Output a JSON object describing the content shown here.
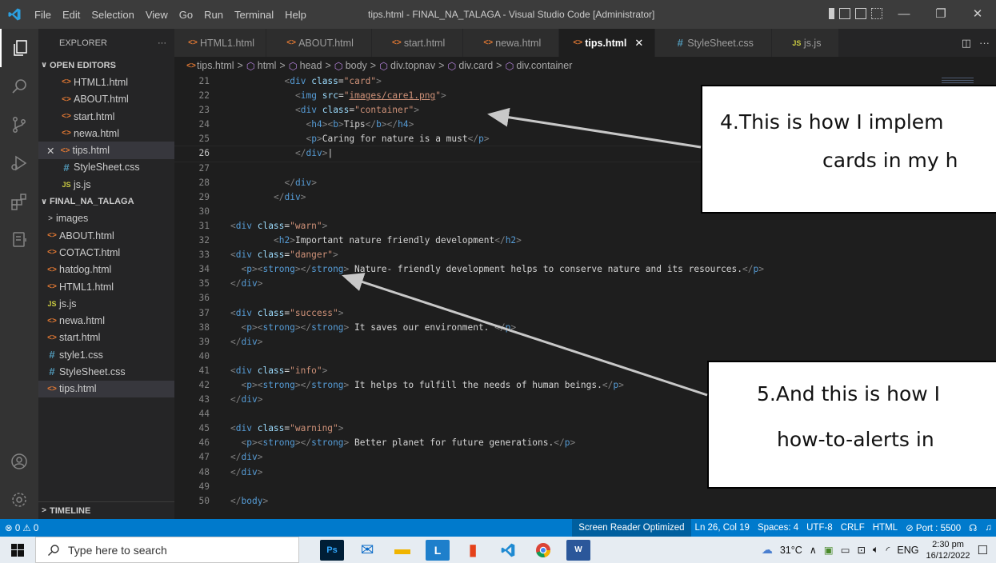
{
  "titlebar": {
    "menu": [
      "File",
      "Edit",
      "Selection",
      "View",
      "Go",
      "Run",
      "Terminal",
      "Help"
    ],
    "window_title": "tips.html - FINAL_NA_TALAGA - Visual Studio Code [Administrator]"
  },
  "sidebar": {
    "explorer_title": "EXPLORER",
    "more": "···",
    "open_editors_title": "OPEN EDITORS",
    "open_editors": [
      {
        "label": "HTML1.html",
        "icon": "html"
      },
      {
        "label": "ABOUT.html",
        "icon": "html"
      },
      {
        "label": "start.html",
        "icon": "html"
      },
      {
        "label": "newa.html",
        "icon": "html"
      },
      {
        "label": "tips.html",
        "icon": "html",
        "close": "✕"
      },
      {
        "label": "StyleSheet.css",
        "icon": "css"
      },
      {
        "label": "js.js",
        "icon": "js"
      }
    ],
    "folder_title": "FINAL_NA_TALAGA",
    "folder_items": [
      {
        "label": "images",
        "icon": "folder"
      },
      {
        "label": "ABOUT.html",
        "icon": "html"
      },
      {
        "label": "COTACT.html",
        "icon": "html"
      },
      {
        "label": "hatdog.html",
        "icon": "html"
      },
      {
        "label": "HTML1.html",
        "icon": "html"
      },
      {
        "label": "js.js",
        "icon": "js"
      },
      {
        "label": "newa.html",
        "icon": "html"
      },
      {
        "label": "start.html",
        "icon": "html"
      },
      {
        "label": "style1.css",
        "icon": "css"
      },
      {
        "label": "StyleSheet.css",
        "icon": "css"
      },
      {
        "label": "tips.html",
        "icon": "html"
      }
    ],
    "timeline_title": "TIMELINE"
  },
  "tabs": [
    {
      "label": "HTML1.html",
      "icon": "html"
    },
    {
      "label": "ABOUT.html",
      "icon": "html"
    },
    {
      "label": "start.html",
      "icon": "html"
    },
    {
      "label": "newa.html",
      "icon": "html"
    },
    {
      "label": "tips.html",
      "icon": "html",
      "active": true
    },
    {
      "label": "StyleSheet.css",
      "icon": "css"
    },
    {
      "label": "js.js",
      "icon": "js"
    }
  ],
  "breadcrumb": [
    "tips.html",
    "html",
    "head",
    "body",
    "div.topnav",
    "div.card",
    "div.container"
  ],
  "code_lines": [
    {
      "n": "21",
      "indent": 10,
      "html": "<span class='p'>&lt;</span><span class='t'>div</span> <span class='a'>class</span><span class='w'>=</span><span class='s'>\"card\"</span><span class='p'>&gt;</span>"
    },
    {
      "n": "22",
      "indent": 12,
      "html": "<span class='p'>&lt;</span><span class='t'>img</span> <span class='a'>src</span><span class='w'>=</span><span class='s'>\"<u>images/care1.png</u>\"</span><span class='p'>&gt;</span>"
    },
    {
      "n": "23",
      "indent": 12,
      "html": "<span class='p'>&lt;</span><span class='t'>div</span> <span class='a'>class</span><span class='w'>=</span><span class='s'>\"container\"</span><span class='p'>&gt;</span>"
    },
    {
      "n": "24",
      "indent": 14,
      "html": "<span class='p'>&lt;</span><span class='t'>h4</span><span class='p'>&gt;&lt;</span><span class='t'>b</span><span class='p'>&gt;</span>Tips<span class='p'>&lt;/</span><span class='t'>b</span><span class='p'>&gt;&lt;/</span><span class='t'>h4</span><span class='p'>&gt;</span>"
    },
    {
      "n": "25",
      "indent": 14,
      "html": "<span class='p'>&lt;</span><span class='t'>p</span><span class='p'>&gt;</span>Caring for nature is a must<span class='p'>&lt;/</span><span class='t'>p</span><span class='p'>&gt;</span>"
    },
    {
      "n": "26",
      "indent": 12,
      "cur": true,
      "html": "<span class='p'>&lt;/</span><span class='t'>div</span><span class='p'>&gt;</span>|"
    },
    {
      "n": "27",
      "indent": 0,
      "html": ""
    },
    {
      "n": "28",
      "indent": 10,
      "html": "<span class='p'>&lt;/</span><span class='t'>div</span><span class='p'>&gt;</span>"
    },
    {
      "n": "29",
      "indent": 8,
      "html": "<span class='p'>&lt;/</span><span class='t'>div</span><span class='p'>&gt;</span>"
    },
    {
      "n": "30",
      "indent": 0,
      "html": ""
    },
    {
      "n": "31",
      "indent": 0,
      "html": "<span class='p'>&lt;</span><span class='t'>div</span> <span class='a'>class</span><span class='w'>=</span><span class='s'>\"warn\"</span><span class='p'>&gt;</span>"
    },
    {
      "n": "32",
      "indent": 8,
      "html": "<span class='p'>&lt;</span><span class='t'>h2</span><span class='p'>&gt;</span>Important nature friendly development<span class='p'>&lt;/</span><span class='t'>h2</span><span class='p'>&gt;</span>"
    },
    {
      "n": "33",
      "indent": 0,
      "html": "<span class='p'>&lt;</span><span class='t'>div</span> <span class='a'>class</span><span class='w'>=</span><span class='s'>\"danger\"</span><span class='p'>&gt;</span>"
    },
    {
      "n": "34",
      "indent": 2,
      "html": "<span class='p'>&lt;</span><span class='t'>p</span><span class='p'>&gt;&lt;</span><span class='t'>strong</span><span class='p'>&gt;&lt;/</span><span class='t'>strong</span><span class='p'>&gt;</span> Nature- friendly development helps to conserve nature and its resources.<span class='p'>&lt;/</span><span class='t'>p</span><span class='p'>&gt;</span>"
    },
    {
      "n": "35",
      "indent": 0,
      "html": "<span class='p'>&lt;/</span><span class='t'>div</span><span class='p'>&gt;</span>"
    },
    {
      "n": "36",
      "indent": 0,
      "html": ""
    },
    {
      "n": "37",
      "indent": 0,
      "html": "<span class='p'>&lt;</span><span class='t'>div</span> <span class='a'>class</span><span class='w'>=</span><span class='s'>\"success\"</span><span class='p'>&gt;</span>"
    },
    {
      "n": "38",
      "indent": 2,
      "html": "<span class='p'>&lt;</span><span class='t'>p</span><span class='p'>&gt;&lt;</span><span class='t'>strong</span><span class='p'>&gt;&lt;/</span><span class='t'>strong</span><span class='p'>&gt;</span> It saves our environment. <span class='p'>&lt;/</span><span class='t'>p</span><span class='p'>&gt;</span>"
    },
    {
      "n": "39",
      "indent": 0,
      "html": "<span class='p'>&lt;/</span><span class='t'>div</span><span class='p'>&gt;</span>"
    },
    {
      "n": "40",
      "indent": 0,
      "html": ""
    },
    {
      "n": "41",
      "indent": 0,
      "html": "<span class='p'>&lt;</span><span class='t'>div</span> <span class='a'>class</span><span class='w'>=</span><span class='s'>\"info\"</span><span class='p'>&gt;</span>"
    },
    {
      "n": "42",
      "indent": 2,
      "html": "<span class='p'>&lt;</span><span class='t'>p</span><span class='p'>&gt;&lt;</span><span class='t'>strong</span><span class='p'>&gt;&lt;/</span><span class='t'>strong</span><span class='p'>&gt;</span> It helps to fulfill the needs of human beings.<span class='p'>&lt;/</span><span class='t'>p</span><span class='p'>&gt;</span>"
    },
    {
      "n": "43",
      "indent": 0,
      "html": "<span class='p'>&lt;/</span><span class='t'>div</span><span class='p'>&gt;</span>"
    },
    {
      "n": "44",
      "indent": 0,
      "html": ""
    },
    {
      "n": "45",
      "indent": 0,
      "html": "<span class='p'>&lt;</span><span class='t'>div</span> <span class='a'>class</span><span class='w'>=</span><span class='s'>\"warning\"</span><span class='p'>&gt;</span>"
    },
    {
      "n": "46",
      "indent": 2,
      "html": "<span class='p'>&lt;</span><span class='t'>p</span><span class='p'>&gt;&lt;</span><span class='t'>strong</span><span class='p'>&gt;&lt;/</span><span class='t'>strong</span><span class='p'>&gt;</span> Better planet for future generations.<span class='p'>&lt;/</span><span class='t'>p</span><span class='p'>&gt;</span>"
    },
    {
      "n": "47",
      "indent": 0,
      "html": "<span class='p'>&lt;/</span><span class='t'>div</span><span class='p'>&gt;</span>"
    },
    {
      "n": "48",
      "indent": 0,
      "html": "<span class='p'>&lt;/</span><span class='t'>div</span><span class='p'>&gt;</span>"
    },
    {
      "n": "49",
      "indent": 0,
      "html": ""
    },
    {
      "n": "50",
      "indent": 0,
      "html": "<span class='p'>&lt;/</span><span class='t'>body</span><span class='p'>&gt;</span>"
    }
  ],
  "callouts": {
    "one": {
      "line1": "4.This is how I implem",
      "line2": "cards in my h"
    },
    "two": {
      "line1": "5.And this is how I",
      "line2": "how-to-alerts in"
    }
  },
  "statusbar": {
    "problems": "⊗ 0 ⚠ 0",
    "screen_reader": "Screen Reader Optimized",
    "position": "Ln 26, Col 19",
    "spaces": "Spaces: 4",
    "encoding": "UTF-8",
    "eol": "CRLF",
    "language": "HTML",
    "port": "⊘ Port : 5500"
  },
  "taskbar": {
    "search_placeholder": "Type here to search",
    "weather": "31°C",
    "language": "ENG",
    "time": "2:30 pm",
    "date": "16/12/2022"
  },
  "colors": {
    "statusbar": "#007acc",
    "titlebar": "#3c3c3c",
    "activitybar": "#333333",
    "sidebar": "#252526",
    "editor": "#1e1e1e"
  }
}
